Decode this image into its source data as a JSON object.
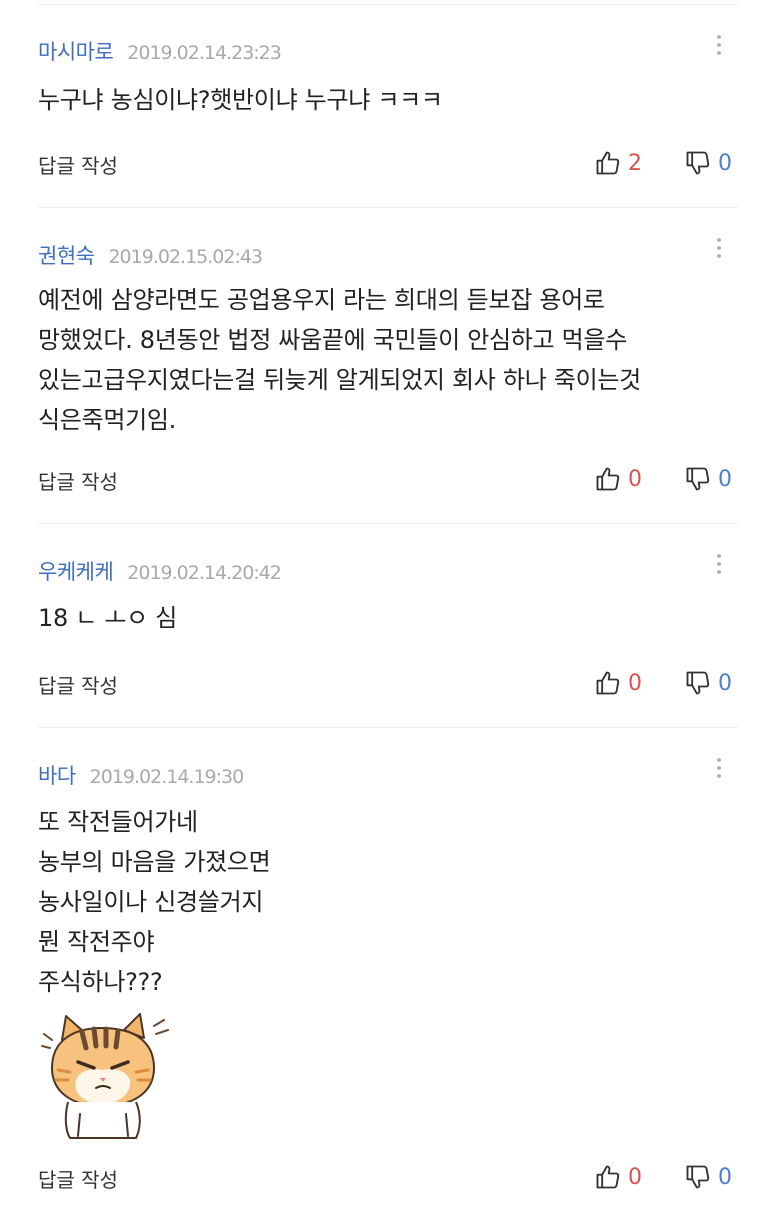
{
  "comments": [
    {
      "author": "마시마로",
      "date": "2019.02.14.23:23",
      "lines": [
        "누구냐 농심이냐?햇반이냐 누구냐 ㅋㅋㅋ"
      ],
      "reply_label": "답글 작성",
      "likes": "2",
      "dislikes": "0"
    },
    {
      "author": "권현숙",
      "date": "2019.02.15.02:43",
      "lines": [
        "예전에 삼양라면도 공업용우지 라는 희대의 듣보잡 용어로",
        "망했었다. 8년동안 법정 싸움끝에  국민들이 안심하고 먹을수",
        "있는고급우지였다는걸 뒤늦게 알게되었지 회사 하나 죽이는것",
        "식은죽먹기임."
      ],
      "reply_label": "답글 작성",
      "likes": "0",
      "dislikes": "0"
    },
    {
      "author": "우케케케",
      "date": "2019.02.14.20:42",
      "lines": [
        "18 ㄴ ㅗㅇ 심"
      ],
      "reply_label": "답글 작성",
      "likes": "0",
      "dislikes": "0"
    },
    {
      "author": "바다",
      "date": "2019.02.14.19:30",
      "lines": [
        "또 작전들어가네",
        "농부의 마음을 가졌으면",
        "농사일이나 신경쓸거지",
        "뭔 작전주야",
        "주식하나???"
      ],
      "reply_label": "답글 작성",
      "likes": "0",
      "dislikes": "0"
    }
  ],
  "colors": {
    "author": "#3f6ec2",
    "like": "#d9534f",
    "dislike": "#4a7fd0"
  },
  "icons": {
    "like": "thumbs-up-icon",
    "dislike": "thumbs-down-icon",
    "more": "more-vertical-icon",
    "sticker": "angry-cat-sticker"
  }
}
